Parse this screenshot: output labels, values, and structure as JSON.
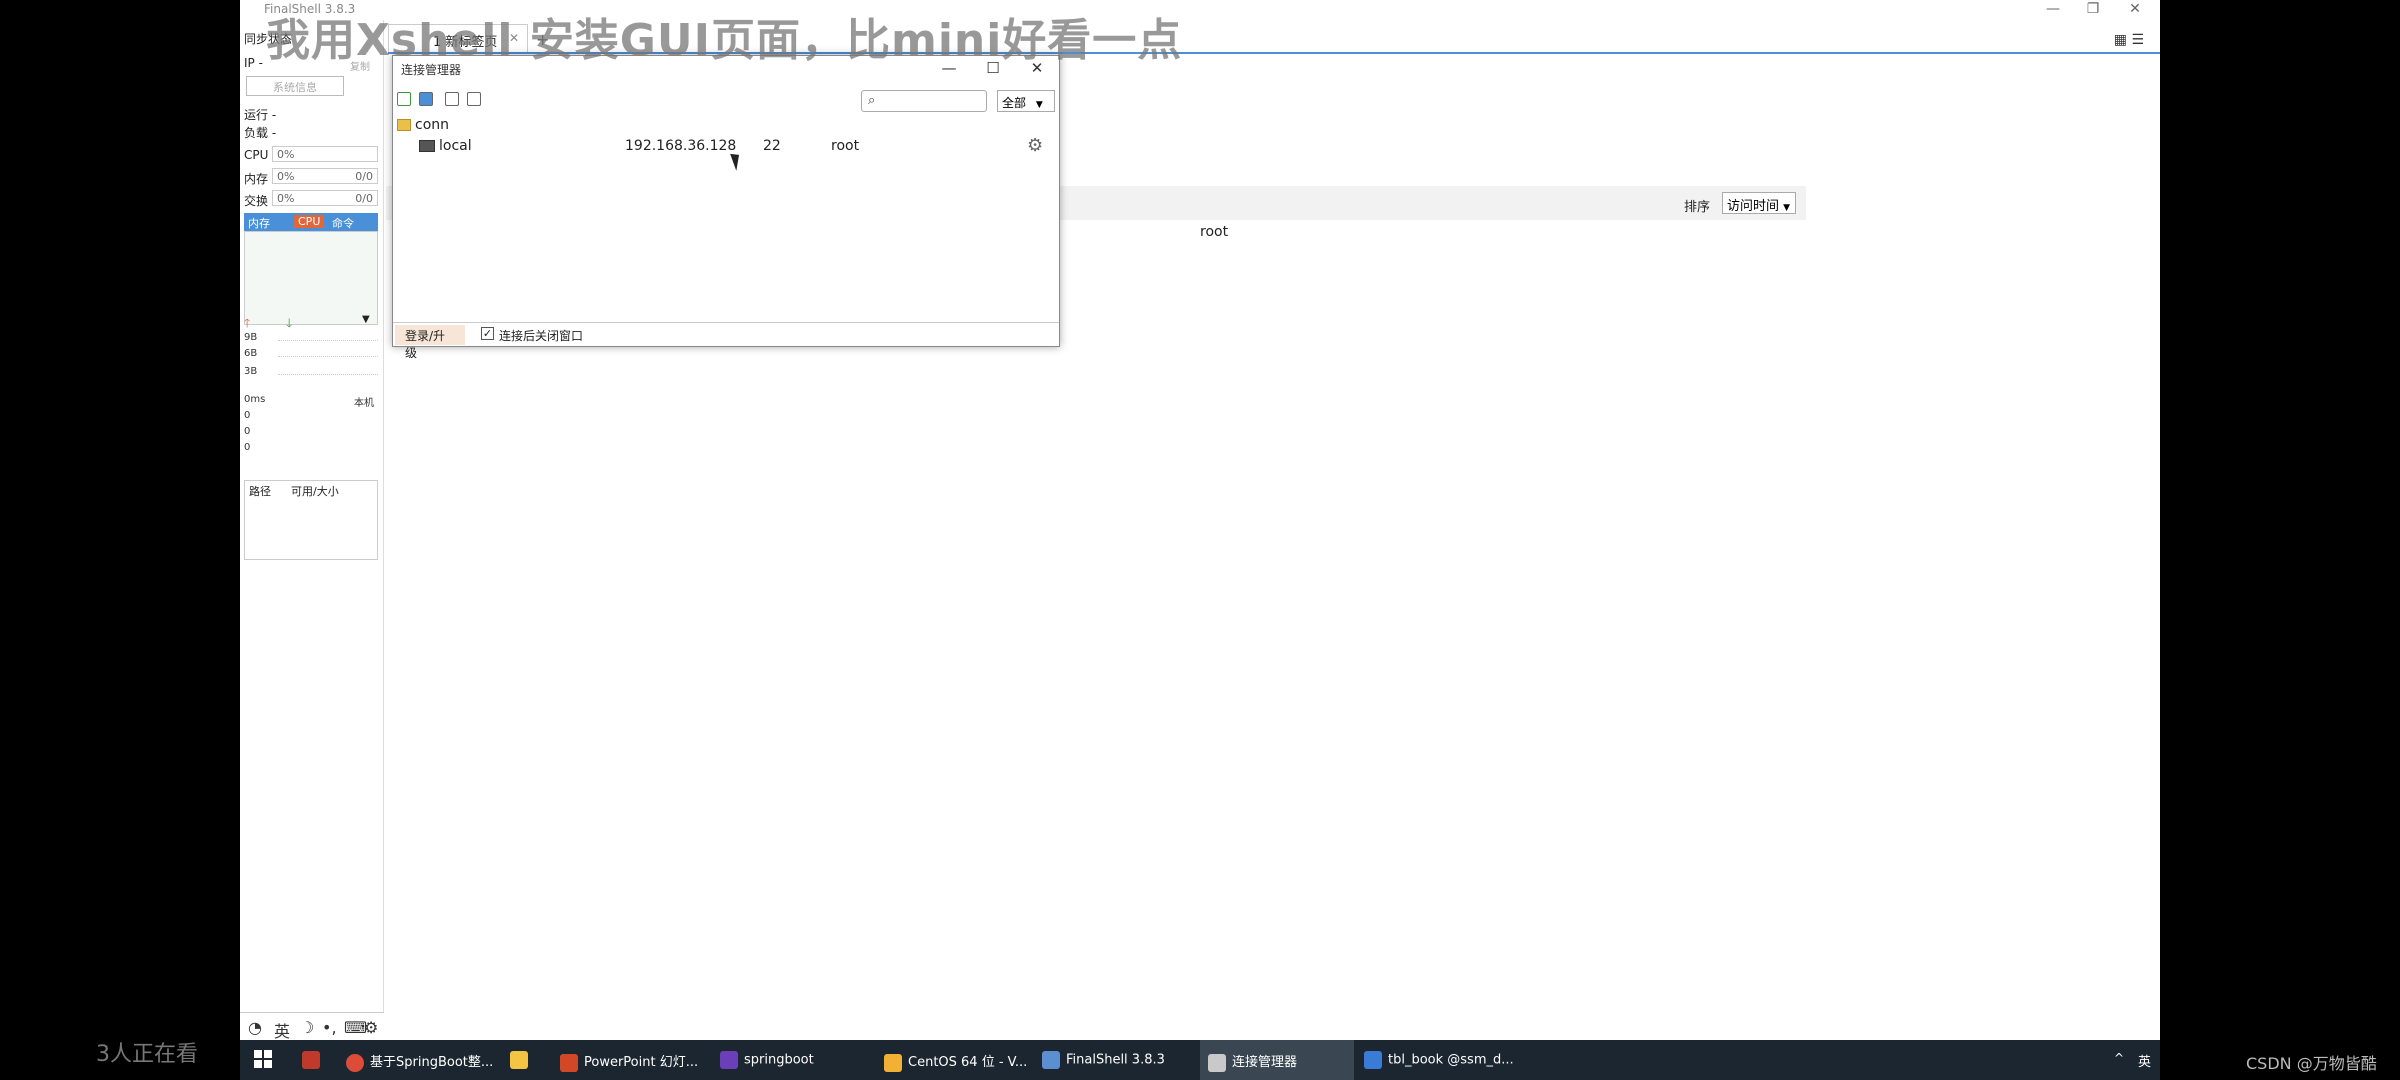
{
  "caption": "我用Xshell 安装GUI页面，比mini好看一点",
  "app": {
    "title": "FinalShell 3.8.3",
    "window_controls": [
      "—",
      "❐",
      "✕"
    ]
  },
  "left_panel": {
    "sync_label": "同步状态",
    "ip_label": "IP",
    "ip_value": "-",
    "copy_label": "复制",
    "sysinfo_button": "系统信息",
    "run_label": "运行",
    "run_value": "-",
    "load_label": "负载",
    "load_value": "-",
    "cpu_label": "CPU",
    "cpu_value": "0%",
    "mem_label": "内存",
    "mem_value": "0%",
    "mem_used": "0/0",
    "swap_label": "交换",
    "swap_value": "0%",
    "swap_used": "0/0",
    "proc_tabs": [
      "内存",
      "CPU",
      "命令"
    ],
    "net_up_icon": "arrow-up-icon",
    "net_down_icon": "arrow-down-icon",
    "net_rows": [
      "9B",
      "6B",
      "3B"
    ],
    "ping_label": "0ms",
    "ping_target": "本机",
    "ping_rows": [
      "0",
      "0",
      "0"
    ],
    "disk_headers": [
      "路径",
      "可用/大小"
    ]
  },
  "tabs": {
    "items": [
      {
        "label": "1 新标签页"
      }
    ],
    "add_label": "+"
  },
  "main": {
    "sort_label": "排序",
    "sort_value": "访问时间",
    "user_value": "root"
  },
  "dialog": {
    "title": "连接管理器",
    "controls": [
      "—",
      "☐",
      "✕"
    ],
    "search_placeholder": "",
    "filter_value": "全部",
    "folder": "conn",
    "connection": {
      "name": "local",
      "host": "192.168.36.128",
      "port": "22",
      "user": "root"
    },
    "login_button": "登录/升级",
    "close_after_connect_label": "连接后关闭窗口",
    "close_after_connect_checked": true
  },
  "app_toolbar": [
    "◔",
    "英",
    "☽",
    "•,",
    "⌨",
    "⚙"
  ],
  "taskbar": {
    "items": [
      {
        "label": "基于SpringBoot整...",
        "color": "#dd4b39"
      },
      {
        "label": "",
        "color": "#f4c542"
      },
      {
        "label": "PowerPoint 幻灯...",
        "color": "#d24726"
      },
      {
        "label": "springboot",
        "color": "#6a3fb8"
      },
      {
        "label": "CentOS 64 位 - V...",
        "color": "#f2b134"
      },
      {
        "label": "FinalShell 3.8.3",
        "color": "#5b8fd1"
      },
      {
        "label": "连接管理器",
        "color": "#c9c9c9"
      },
      {
        "label": "tbl_book @ssm_d...",
        "color": "#3a7bd5"
      }
    ],
    "tray_lang": "英"
  },
  "overlay": {
    "viewers": "3人正在看",
    "watermark": "CSDN @万物皆酷"
  }
}
